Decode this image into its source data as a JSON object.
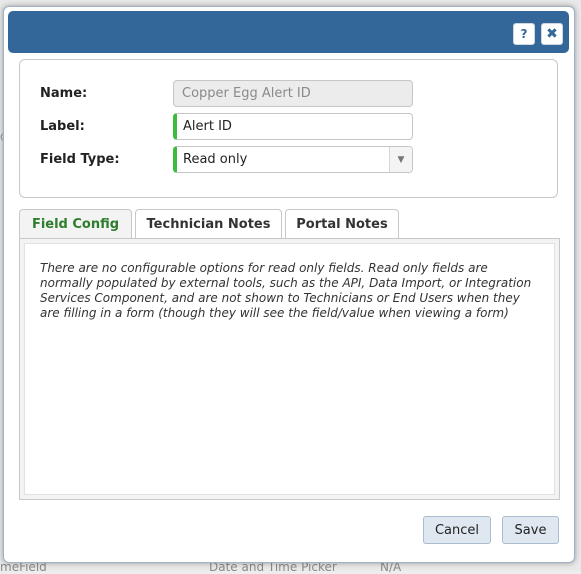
{
  "background": {
    "row_left": "meField",
    "row_mid": "Date and Time Picker",
    "row_right": "N/A"
  },
  "dialog": {
    "help_label": "?",
    "close_label": "✖"
  },
  "form": {
    "name_label": "Name:",
    "name_value": "Copper Egg Alert ID",
    "label_label": "Label:",
    "label_value": "Alert ID",
    "field_type_label": "Field Type:",
    "field_type_value": "Read only"
  },
  "tabs": [
    {
      "label": "Field Config",
      "active": true
    },
    {
      "label": "Technician Notes",
      "active": false
    },
    {
      "label": "Portal Notes",
      "active": false
    }
  ],
  "panel": {
    "text": "There are no configurable options for read only fields. Read only fields are normally populated by external tools, such as the API, Data Import, or Integration Services Component, and are not shown to Technicians or End Users when they are filling in a form (though they will see the field/value when viewing a form)"
  },
  "buttons": {
    "cancel": "Cancel",
    "save": "Save"
  },
  "colors": {
    "titlebar": "#336699",
    "active_tab_text": "#2d7d2d",
    "required_marker": "#3cbc3c",
    "button_bg": "#dfe8f1"
  }
}
